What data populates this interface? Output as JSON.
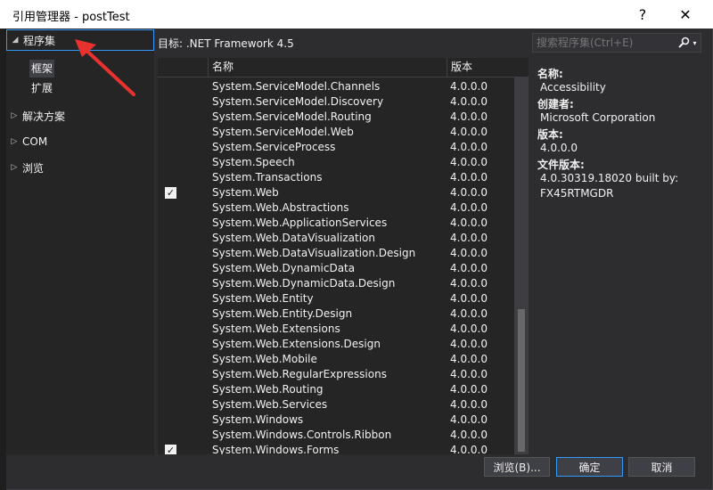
{
  "window": {
    "title": "引用管理器 - postTest"
  },
  "titlebar": {
    "help": "?",
    "close": "✕"
  },
  "sidebar": {
    "header": "程序集",
    "sub_items": [
      "框架",
      "扩展"
    ],
    "groups": [
      "解决方案",
      "COM",
      "浏览"
    ]
  },
  "target": {
    "label": "目标: .NET Framework 4.5"
  },
  "search": {
    "placeholder": "搜索程序集(Ctrl+E)",
    "icon": "search-icon"
  },
  "table": {
    "columns": [
      "名称",
      "版本"
    ],
    "rows": [
      {
        "name": "System.ServiceModel.Channels",
        "version": "4.0.0.0",
        "checked": false
      },
      {
        "name": "System.ServiceModel.Discovery",
        "version": "4.0.0.0",
        "checked": false
      },
      {
        "name": "System.ServiceModel.Routing",
        "version": "4.0.0.0",
        "checked": false
      },
      {
        "name": "System.ServiceModel.Web",
        "version": "4.0.0.0",
        "checked": false
      },
      {
        "name": "System.ServiceProcess",
        "version": "4.0.0.0",
        "checked": false
      },
      {
        "name": "System.Speech",
        "version": "4.0.0.0",
        "checked": false
      },
      {
        "name": "System.Transactions",
        "version": "4.0.0.0",
        "checked": false
      },
      {
        "name": "System.Web",
        "version": "4.0.0.0",
        "checked": true
      },
      {
        "name": "System.Web.Abstractions",
        "version": "4.0.0.0",
        "checked": false
      },
      {
        "name": "System.Web.ApplicationServices",
        "version": "4.0.0.0",
        "checked": false
      },
      {
        "name": "System.Web.DataVisualization",
        "version": "4.0.0.0",
        "checked": false
      },
      {
        "name": "System.Web.DataVisualization.Design",
        "version": "4.0.0.0",
        "checked": false
      },
      {
        "name": "System.Web.DynamicData",
        "version": "4.0.0.0",
        "checked": false
      },
      {
        "name": "System.Web.DynamicData.Design",
        "version": "4.0.0.0",
        "checked": false
      },
      {
        "name": "System.Web.Entity",
        "version": "4.0.0.0",
        "checked": false
      },
      {
        "name": "System.Web.Entity.Design",
        "version": "4.0.0.0",
        "checked": false
      },
      {
        "name": "System.Web.Extensions",
        "version": "4.0.0.0",
        "checked": false
      },
      {
        "name": "System.Web.Extensions.Design",
        "version": "4.0.0.0",
        "checked": false
      },
      {
        "name": "System.Web.Mobile",
        "version": "4.0.0.0",
        "checked": false
      },
      {
        "name": "System.Web.RegularExpressions",
        "version": "4.0.0.0",
        "checked": false
      },
      {
        "name": "System.Web.Routing",
        "version": "4.0.0.0",
        "checked": false
      },
      {
        "name": "System.Web.Services",
        "version": "4.0.0.0",
        "checked": false
      },
      {
        "name": "System.Windows",
        "version": "4.0.0.0",
        "checked": false
      },
      {
        "name": "System.Windows.Controls.Ribbon",
        "version": "4.0.0.0",
        "checked": false
      },
      {
        "name": "System.Windows.Forms",
        "version": "4.0.0.0",
        "checked": true
      }
    ]
  },
  "details": {
    "name_label": "名称:",
    "name_value": "Accessibility",
    "creator_label": "创建者:",
    "creator_value": "Microsoft Corporation",
    "version_label": "版本:",
    "version_value": "4.0.0.0",
    "file_version_label": "文件版本:",
    "file_version_value_1": "4.0.30319.18020 built by:",
    "file_version_value_2": "FX45RTMGDR"
  },
  "buttons": {
    "browse": "浏览(B)...",
    "ok": "确定",
    "cancel": "取消"
  },
  "colors": {
    "accent": "#3399ff",
    "annotation_arrow": "#e8322e"
  }
}
